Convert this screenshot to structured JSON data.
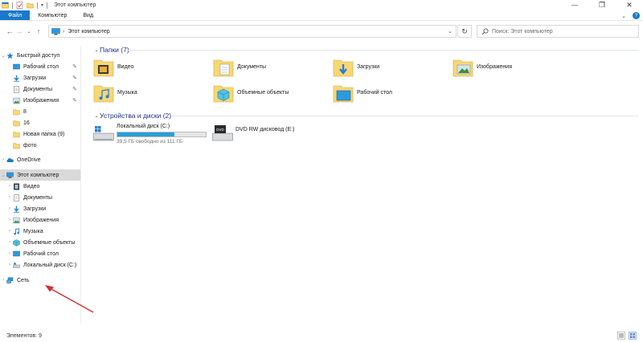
{
  "window": {
    "title": "Этот компьютер",
    "controls": [
      "minimize",
      "maximize",
      "close"
    ]
  },
  "ribbon": {
    "tabs": [
      {
        "label": "Файл",
        "active": true
      },
      {
        "label": "Компьютер"
      },
      {
        "label": "Вид"
      }
    ]
  },
  "address": {
    "path": "Этот компьютер",
    "search_placeholder": "Поиск: Этот компьютер"
  },
  "nav": {
    "quick_access": {
      "label": "Быстрый доступ",
      "items": [
        {
          "label": "Рабочий стол",
          "icon": "desktop-icon",
          "pinned": true
        },
        {
          "label": "Загрузки",
          "icon": "downloads-icon",
          "pinned": true
        },
        {
          "label": "Документы",
          "icon": "documents-icon",
          "pinned": true
        },
        {
          "label": "Изображения",
          "icon": "pictures-icon",
          "pinned": true
        },
        {
          "label": "8",
          "icon": "folder-icon"
        },
        {
          "label": "16",
          "icon": "folder-icon"
        },
        {
          "label": "Новая папка (9)",
          "icon": "folder-icon"
        },
        {
          "label": "фото",
          "icon": "folder-icon"
        }
      ]
    },
    "onedrive": {
      "label": "OneDrive"
    },
    "this_pc": {
      "label": "Этот компьютер",
      "items": [
        {
          "label": "Видео",
          "icon": "video-icon"
        },
        {
          "label": "Документы",
          "icon": "documents-icon"
        },
        {
          "label": "Загрузки",
          "icon": "downloads-icon"
        },
        {
          "label": "Изображения",
          "icon": "pictures-icon"
        },
        {
          "label": "Музыка",
          "icon": "music-icon"
        },
        {
          "label": "Объемные объекты",
          "icon": "3d-objects-icon"
        },
        {
          "label": "Рабочий стол",
          "icon": "desktop-icon"
        },
        {
          "label": "Локальный диск (C:)",
          "icon": "drive-icon"
        }
      ]
    },
    "network": {
      "label": "Сеть"
    }
  },
  "main": {
    "folders_header": "Папки (7)",
    "folders": [
      {
        "label": "Видео",
        "icon": "video-folder-icon"
      },
      {
        "label": "Документы",
        "icon": "documents-folder-icon"
      },
      {
        "label": "Загрузки",
        "icon": "downloads-folder-icon"
      },
      {
        "label": "Изображения",
        "icon": "pictures-folder-icon"
      },
      {
        "label": "Музыка",
        "icon": "music-folder-icon"
      },
      {
        "label": "Объемные объекты",
        "icon": "3d-objects-folder-icon"
      },
      {
        "label": "Рабочий стол",
        "icon": "desktop-folder-icon"
      }
    ],
    "devices_header": "Устройства и диски (2)",
    "drives": [
      {
        "label": "Локальный диск (C:)",
        "free": "39,5 ГБ свободно из 111 ГБ",
        "used_fraction": 0.644
      },
      {
        "label": "DVD RW дисковод (E:)",
        "badge": "DVD"
      }
    ]
  },
  "status": {
    "items": "Элементов: 9"
  },
  "colors": {
    "accent": "#1979ca",
    "header_text": "#1e3287",
    "drive_fill": "#26a0da",
    "folder_yellow": "#f8d775",
    "annotation_arrow": "#d32f2f"
  }
}
